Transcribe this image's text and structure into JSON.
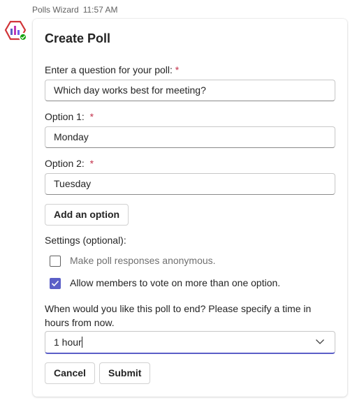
{
  "header": {
    "sender": "Polls Wizard",
    "time": "11:57 AM"
  },
  "card": {
    "title": "Create Poll",
    "question_label": "Enter a question for your poll:",
    "question_value": "Which day works best for meeting?",
    "required_mark": "*",
    "options": [
      {
        "label": "Option 1:",
        "value": "Monday"
      },
      {
        "label": "Option 2:",
        "value": "Tuesday"
      }
    ],
    "add_option_label": "Add an option",
    "settings_label": "Settings (optional):",
    "checkboxes": [
      {
        "label": "Make poll responses anonymous.",
        "checked": false
      },
      {
        "label": "Allow members to vote on more than one option.",
        "checked": true
      }
    ],
    "end_time_label_line1": "When would you like this poll to end? Please specify a time in",
    "end_time_label_line2": "hours from now.",
    "end_time_value": "1 hour",
    "cancel_label": "Cancel",
    "submit_label": "Submit"
  },
  "colors": {
    "accent": "#5b5fc7",
    "required": "#c4314b",
    "avatar_ring": "#d13438",
    "online": "#13a10e"
  },
  "icons": {
    "avatar": "polls-bar-chart-icon",
    "status": "online-check-icon",
    "checkbox_checked": "checkmark-icon",
    "dropdown": "chevron-down-icon"
  }
}
